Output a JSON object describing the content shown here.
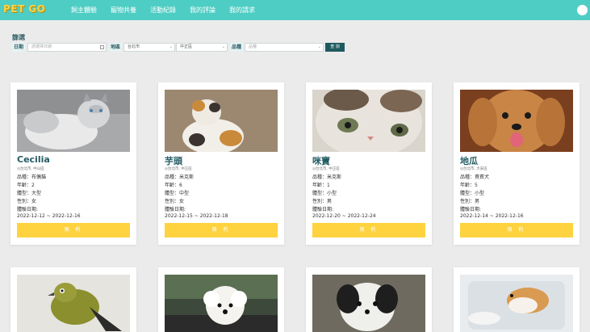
{
  "nav": {
    "logo": "PET GO",
    "items": [
      "飼主體驗",
      "寵物共養",
      "活動紀錄",
      "我的評論",
      "我的請求"
    ]
  },
  "filter": {
    "title": "篩選",
    "date_label": "日期",
    "date_placeholder": "請選擇日期",
    "area_label": "地區",
    "city_value": "台北市",
    "district_value": "中正區",
    "breed_label": "品種",
    "breed_placeholder": "品種",
    "search_label": "查 詢"
  },
  "cards": [
    {
      "name": "Cecilia",
      "location": "◎台北市, 中山區",
      "breed": "品種：布偶貓",
      "age": "年齡：2",
      "size": "體型：大型",
      "gender": "性別：女",
      "period_label": "體驗日期:",
      "period": "2022-12-12 ~ 2022-12-16",
      "button": "預 約",
      "photo": "gray-white-cat"
    },
    {
      "name": "芋頭",
      "location": "◎台北市, 中正區",
      "breed": "品種：米克斯",
      "age": "年齡：6",
      "size": "體型：中型",
      "gender": "性別：女",
      "period_label": "體驗日期:",
      "period": "2022-12-15 ~ 2022-12-18",
      "button": "預 約",
      "photo": "calico-cat"
    },
    {
      "name": "咪寶",
      "location": "◎台北市, 中正區",
      "breed": "品種：米克斯",
      "age": "年齡：1",
      "size": "體型：小型",
      "gender": "性別：男",
      "period_label": "體驗日期:",
      "period": "2022-12-20 ~ 2022-12-24",
      "button": "預 約",
      "photo": "kitten-face"
    },
    {
      "name": "地瓜",
      "location": "◎台北市, 大安區",
      "breed": "品種：貴賓犬",
      "age": "年齡：5",
      "size": "體型：小型",
      "gender": "性別：男",
      "period_label": "體驗日期:",
      "period": "2022-12-14 ~ 2022-12-16",
      "button": "預 約",
      "photo": "poodle"
    },
    {
      "photo": "bird"
    },
    {
      "photo": "white-poodle-in-car"
    },
    {
      "photo": "black-white-dog"
    },
    {
      "photo": "hamster"
    }
  ]
}
